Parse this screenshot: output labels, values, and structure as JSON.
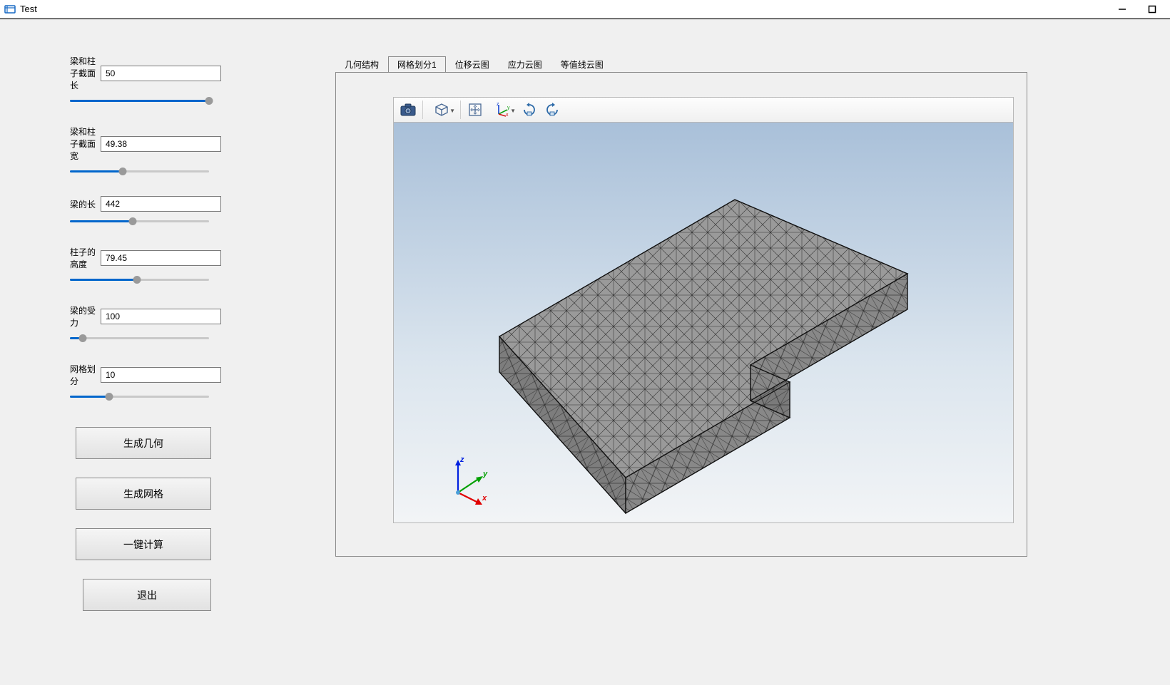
{
  "window": {
    "title": "Test"
  },
  "params": [
    {
      "label": "梁和柱子截面长",
      "value": "50",
      "pct": 100
    },
    {
      "label": "梁和柱子截面宽",
      "value": "49.38",
      "pct": 38
    },
    {
      "label": "梁的长",
      "value": "442",
      "pct": 45
    },
    {
      "label": "柱子的高度",
      "value": "79.45",
      "pct": 48
    },
    {
      "label": "梁的受力",
      "value": "100",
      "pct": 9
    },
    {
      "label": "网格划分",
      "value": "10",
      "pct": 28
    }
  ],
  "buttons": {
    "generate_geometry": "生成几何",
    "generate_mesh": "生成网格",
    "compute": "一键计算",
    "exit": "退出"
  },
  "tabs": [
    {
      "label": "几何结构",
      "active": false
    },
    {
      "label": "网格划分1",
      "active": true
    },
    {
      "label": "位移云图",
      "active": false
    },
    {
      "label": "应力云图",
      "active": false
    },
    {
      "label": "等值线云图",
      "active": false
    }
  ],
  "toolbar_icons": [
    "camera-icon",
    "cube-icon",
    "fit-icon",
    "axis-icon",
    "rotate-cw-icon",
    "rotate-ccw-icon"
  ],
  "axes": {
    "x": "x",
    "y": "y",
    "z": "z"
  }
}
